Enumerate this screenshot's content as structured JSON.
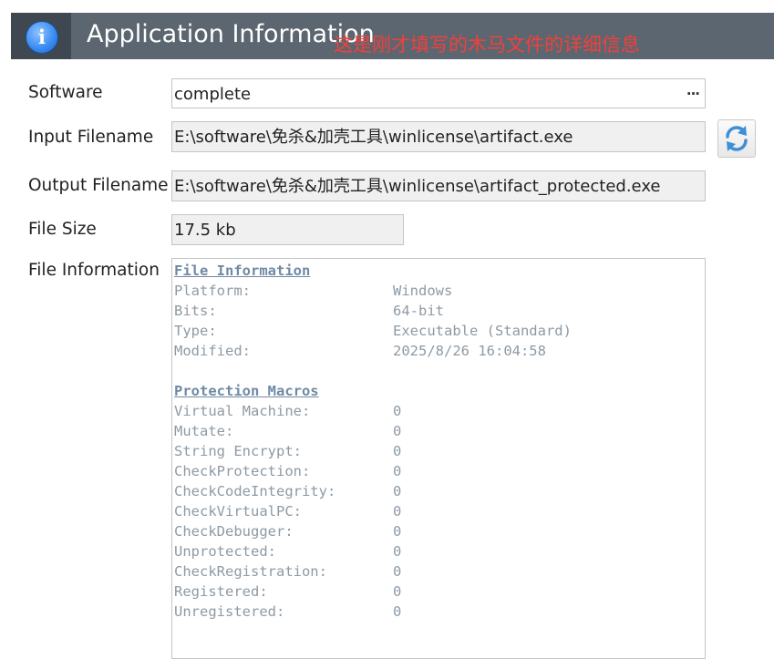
{
  "header": {
    "title": "Application Information",
    "annotation": "这是刚才填写的木马文件的详细信息"
  },
  "form": {
    "software_label": "Software",
    "software_value": "complete",
    "software_button": "···",
    "input_label": "Input Filename",
    "input_value": "E:\\software\\免杀&加壳工具\\winlicense\\artifact.exe",
    "output_label": "Output Filename",
    "output_value": "E:\\software\\免杀&加壳工具\\winlicense\\artifact_protected.exe",
    "size_label": "File Size",
    "size_value": "17.5 kb",
    "info_label": "File Information"
  },
  "file_info": {
    "heading": "File Information",
    "rows": [
      {
        "key": "Platform:",
        "value": "Windows"
      },
      {
        "key": "Bits:",
        "value": "64-bit"
      },
      {
        "key": "Type:",
        "value": "Executable (Standard)"
      },
      {
        "key": "Modified:",
        "value": "2025/8/26 16:04:58"
      }
    ]
  },
  "protection": {
    "heading": "Protection Macros",
    "rows": [
      {
        "key": "Virtual Machine:",
        "value": "0"
      },
      {
        "key": "Mutate:",
        "value": "0"
      },
      {
        "key": "String Encrypt:",
        "value": "0"
      },
      {
        "key": "CheckProtection:",
        "value": "0"
      },
      {
        "key": "CheckCodeIntegrity:",
        "value": "0"
      },
      {
        "key": "CheckVirtualPC:",
        "value": "0"
      },
      {
        "key": "CheckDebugger:",
        "value": "0"
      },
      {
        "key": "Unprotected:",
        "value": "0"
      },
      {
        "key": "CheckRegistration:",
        "value": "0"
      },
      {
        "key": "Registered:",
        "value": "0"
      },
      {
        "key": "Unregistered:",
        "value": "0"
      }
    ]
  },
  "icons": {
    "header": "info-icon",
    "refresh": "refresh-icon"
  },
  "colors": {
    "header_bg": "#5b6670",
    "annotation": "#f2403a",
    "info_text": "#8e9aa4",
    "info_heading": "#6f8aa3"
  }
}
